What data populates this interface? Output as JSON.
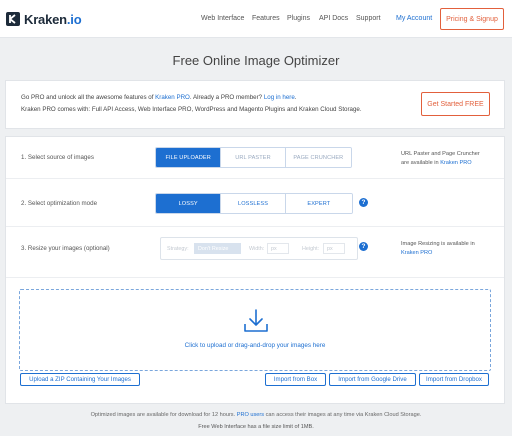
{
  "header": {
    "logo_text": "Kraken",
    "logo_tld": ".io",
    "nav": [
      "Web Interface",
      "Features",
      "Plugins",
      "API Docs",
      "Support"
    ],
    "account": "My Account",
    "pricing": "Pricing & Signup"
  },
  "page_title": "Free Online Image Optimizer",
  "promo": {
    "line1_a": "Go PRO and unlock all the awesome features of ",
    "line1_link": "Kraken PRO",
    "line1_b": ". Already a PRO member? ",
    "line1_login": "Log in here",
    "line1_c": ".",
    "line2": "Kraken PRO comes with: Full API Access, Web Interface PRO, WordPress and Magento Plugins and Kraken Cloud Storage.",
    "cta": "Get Started FREE"
  },
  "step1": {
    "label": "1. Select source of images",
    "options": [
      "FILE UPLOADER",
      "URL PASTER",
      "PAGE CRUNCHER"
    ],
    "active": "FILE UPLOADER",
    "note_line1": "URL Paster and Page Cruncher",
    "note_line2_a": "are available in ",
    "note_line2_link": "Kraken PRO"
  },
  "step2": {
    "label": "2. Select optimization mode",
    "options": [
      "LOSSY",
      "LOSSLESS",
      "EXPERT"
    ],
    "active": "LOSSY",
    "help": "?"
  },
  "step3": {
    "label": "3. Resize your images (optional)",
    "strategy_label": "Strategy:",
    "strategy_value": "Don't Resize",
    "width_label": "Width:",
    "width_placeholder": "px",
    "height_label": "Height:",
    "height_placeholder": "px",
    "help": "?",
    "note_line1": "Image Resizing is available in",
    "note_line2_link": "Kraken PRO"
  },
  "dropzone": {
    "text": "Click to upload or drag-and-drop your images here"
  },
  "buttons": {
    "zip": "Upload a ZIP Containing Your Images",
    "box": "Import from Box",
    "gdrive": "Import from Google Drive",
    "dropbox": "Import from Dropbox"
  },
  "footer": {
    "line1_a": "Optimized images are available for download for 12 hours. ",
    "line1_link": "PRO users",
    "line1_b": " can access their images at any time via Kraken Cloud Storage.",
    "line2": "Free Web Interface has a file size limit of 1MB."
  },
  "colors": {
    "accent": "#1d6fd1",
    "cta": "#e2603c"
  }
}
